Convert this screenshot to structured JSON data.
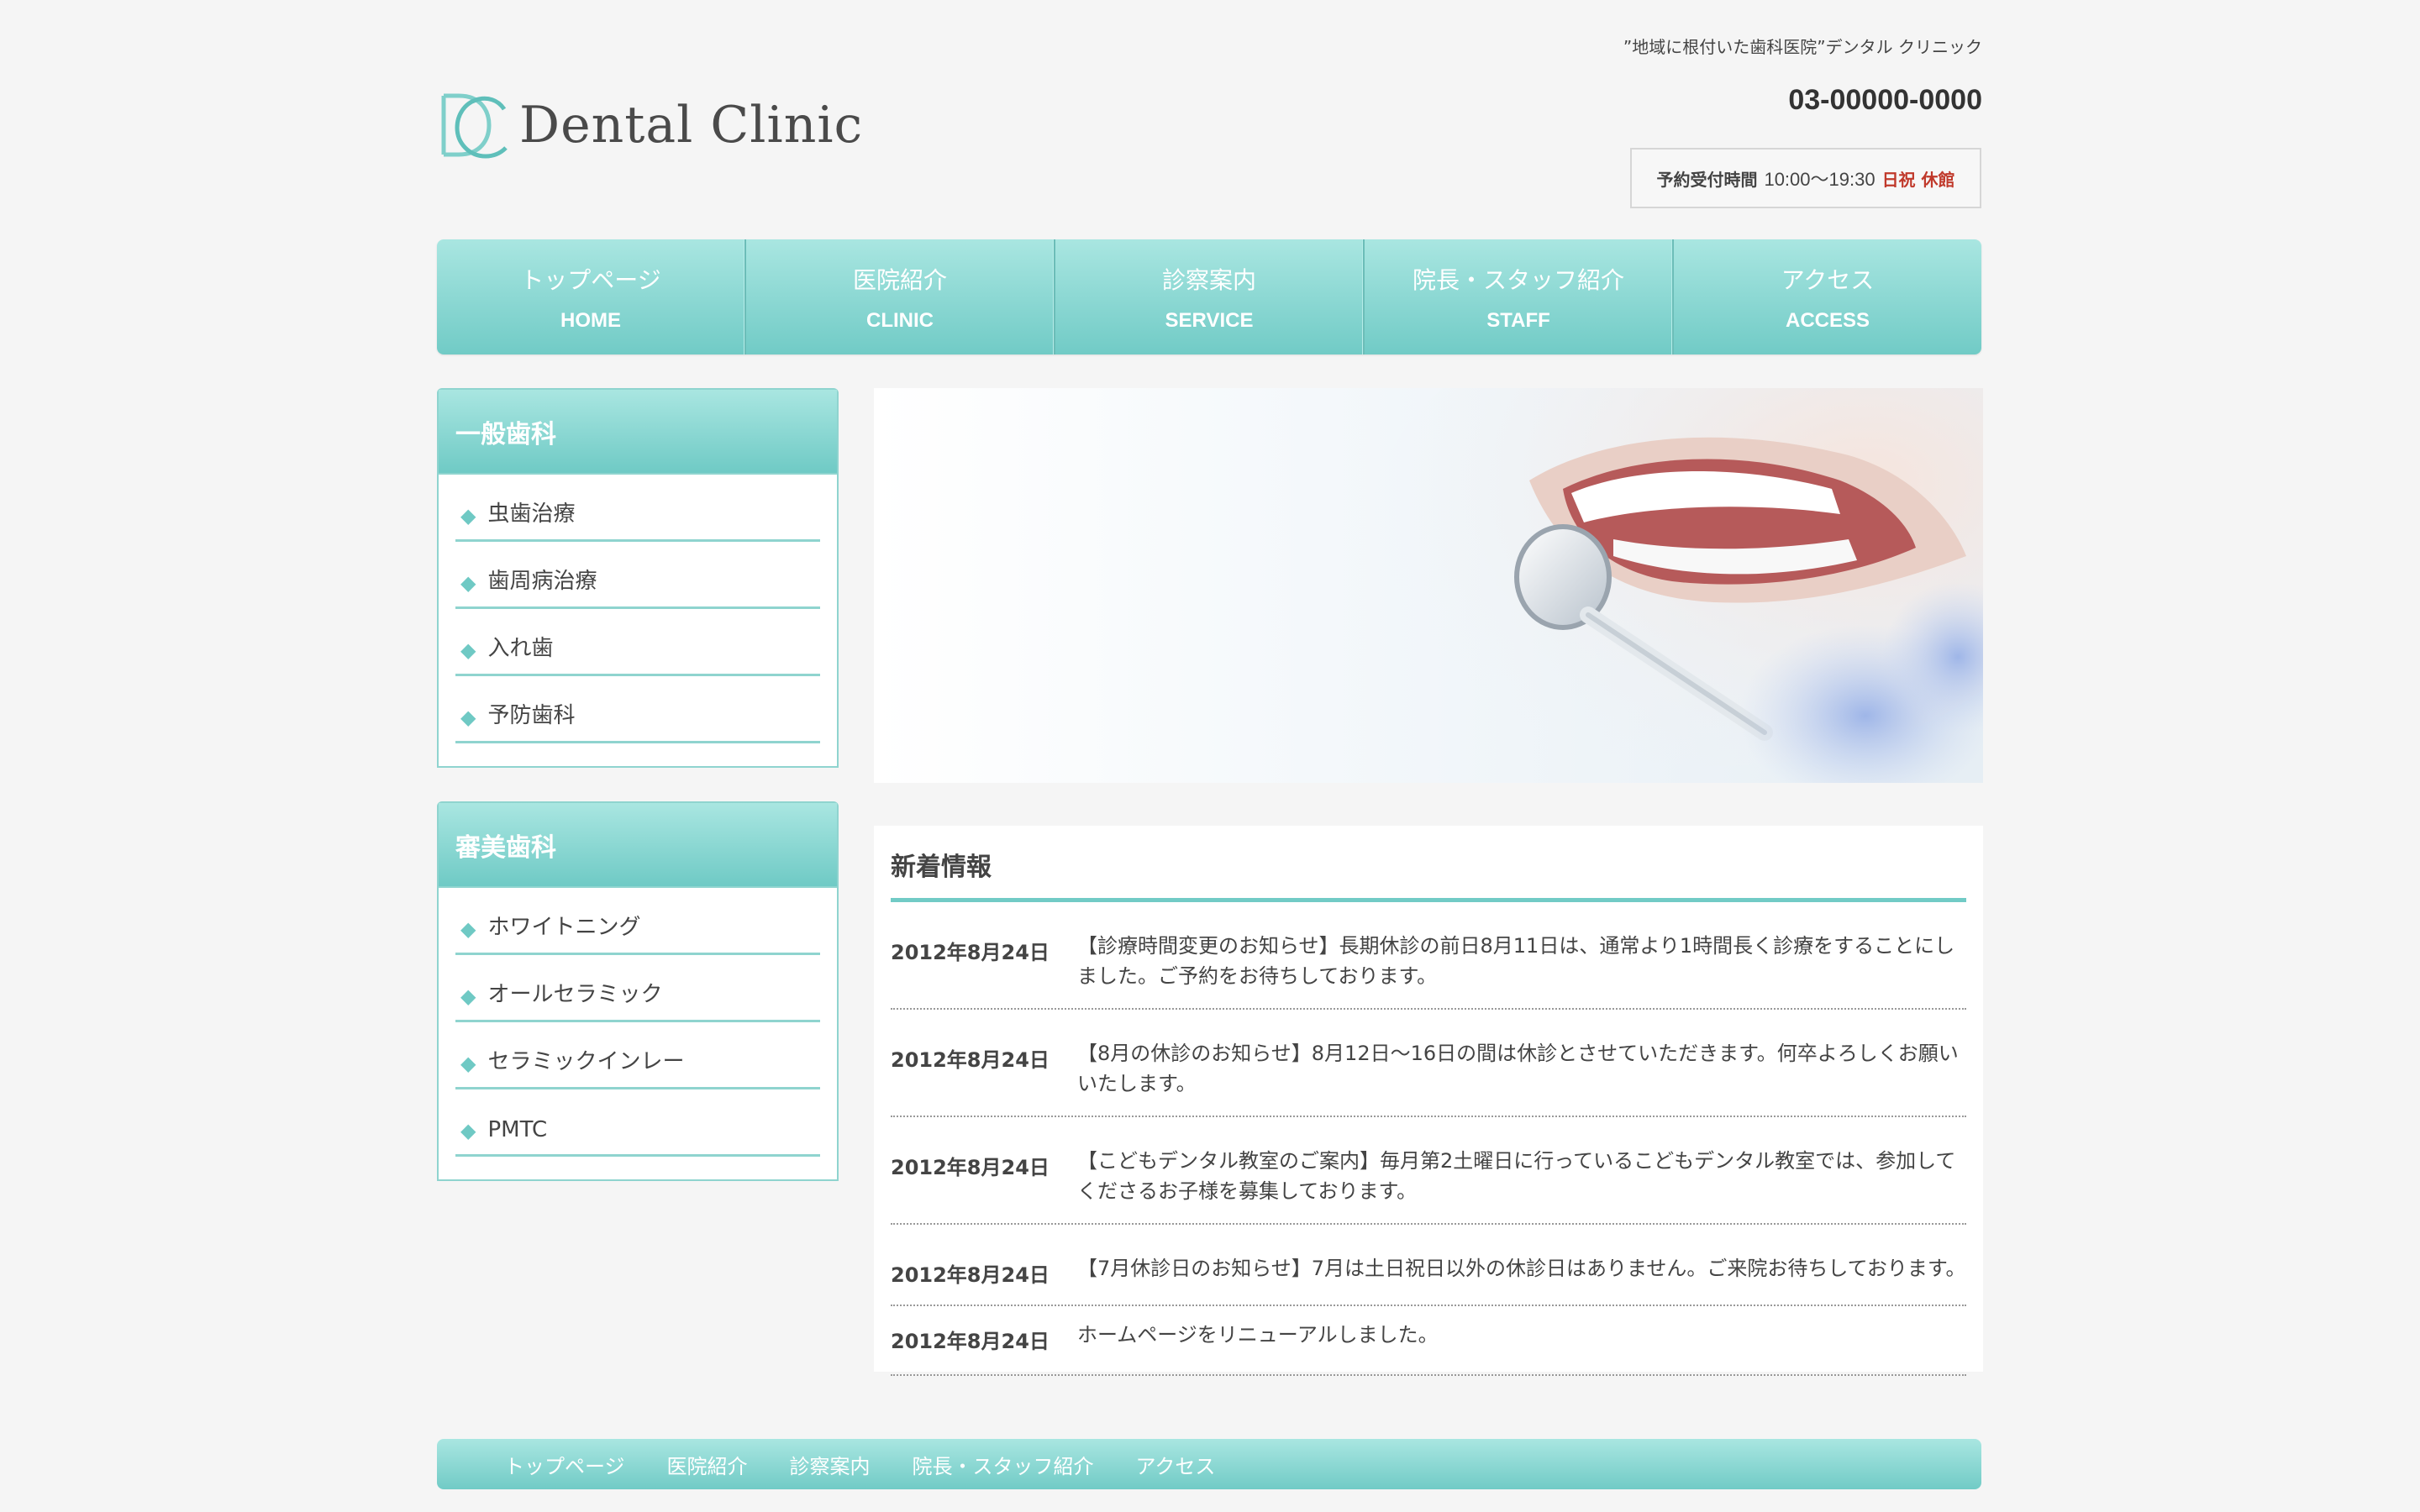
{
  "header": {
    "tagline": "”地域に根付いた歯科医院”デンタル クリニック",
    "logo_text": "Dental Clinic",
    "phone": "03-00000-0000",
    "hours_label": "予約受付時間",
    "hours_time": "10:00〜19:30",
    "hours_closed": "日祝 休館"
  },
  "colors": {
    "accent": "#71cbc6",
    "accent_light": "#a9e6e1",
    "closed_red": "#c0392b"
  },
  "nav": [
    {
      "jp": "トップページ",
      "en": "HOME"
    },
    {
      "jp": "医院紹介",
      "en": "CLINIC"
    },
    {
      "jp": "診察案内",
      "en": "SERVICE"
    },
    {
      "jp": "院長・スタッフ紹介",
      "en": "STAFF"
    },
    {
      "jp": "アクセス",
      "en": "ACCESS"
    }
  ],
  "sidebar": [
    {
      "title": "一般歯科",
      "items": [
        "虫歯治療",
        "歯周病治療",
        "入れ歯",
        "予防歯科"
      ]
    },
    {
      "title": "審美歯科",
      "items": [
        "ホワイトニング",
        "オールセラミック",
        "セラミックインレー",
        "PMTC"
      ]
    }
  ],
  "news": {
    "title": "新着情報",
    "items": [
      {
        "date": "2012年8月24日",
        "text": "【診療時間変更のお知らせ】長期休診の前日8月11日は、通常より1時間長く診療をすることにしました。ご予約をお待ちしております。"
      },
      {
        "date": "2012年8月24日",
        "text": "【8月の休診のお知らせ】8月12日〜16日の間は休診とさせていただきます。何卒よろしくお願いいたします。"
      },
      {
        "date": "2012年8月24日",
        "text": "【こどもデンタル教室のご案内】毎月第2土曜日に行っているこどもデンタル教室では、参加してくださるお子様を募集しております。"
      },
      {
        "date": "2012年8月24日",
        "text": "【7月休診日のお知らせ】7月は土日祝日以外の休診日はありません。ご来院お待ちしております。"
      },
      {
        "date": "2012年8月24日",
        "text": "ホームページをリニューアルしました。"
      }
    ]
  },
  "footer_nav": [
    "トップページ",
    "医院紹介",
    "診察案内",
    "院長・スタッフ紹介",
    "アクセス"
  ]
}
